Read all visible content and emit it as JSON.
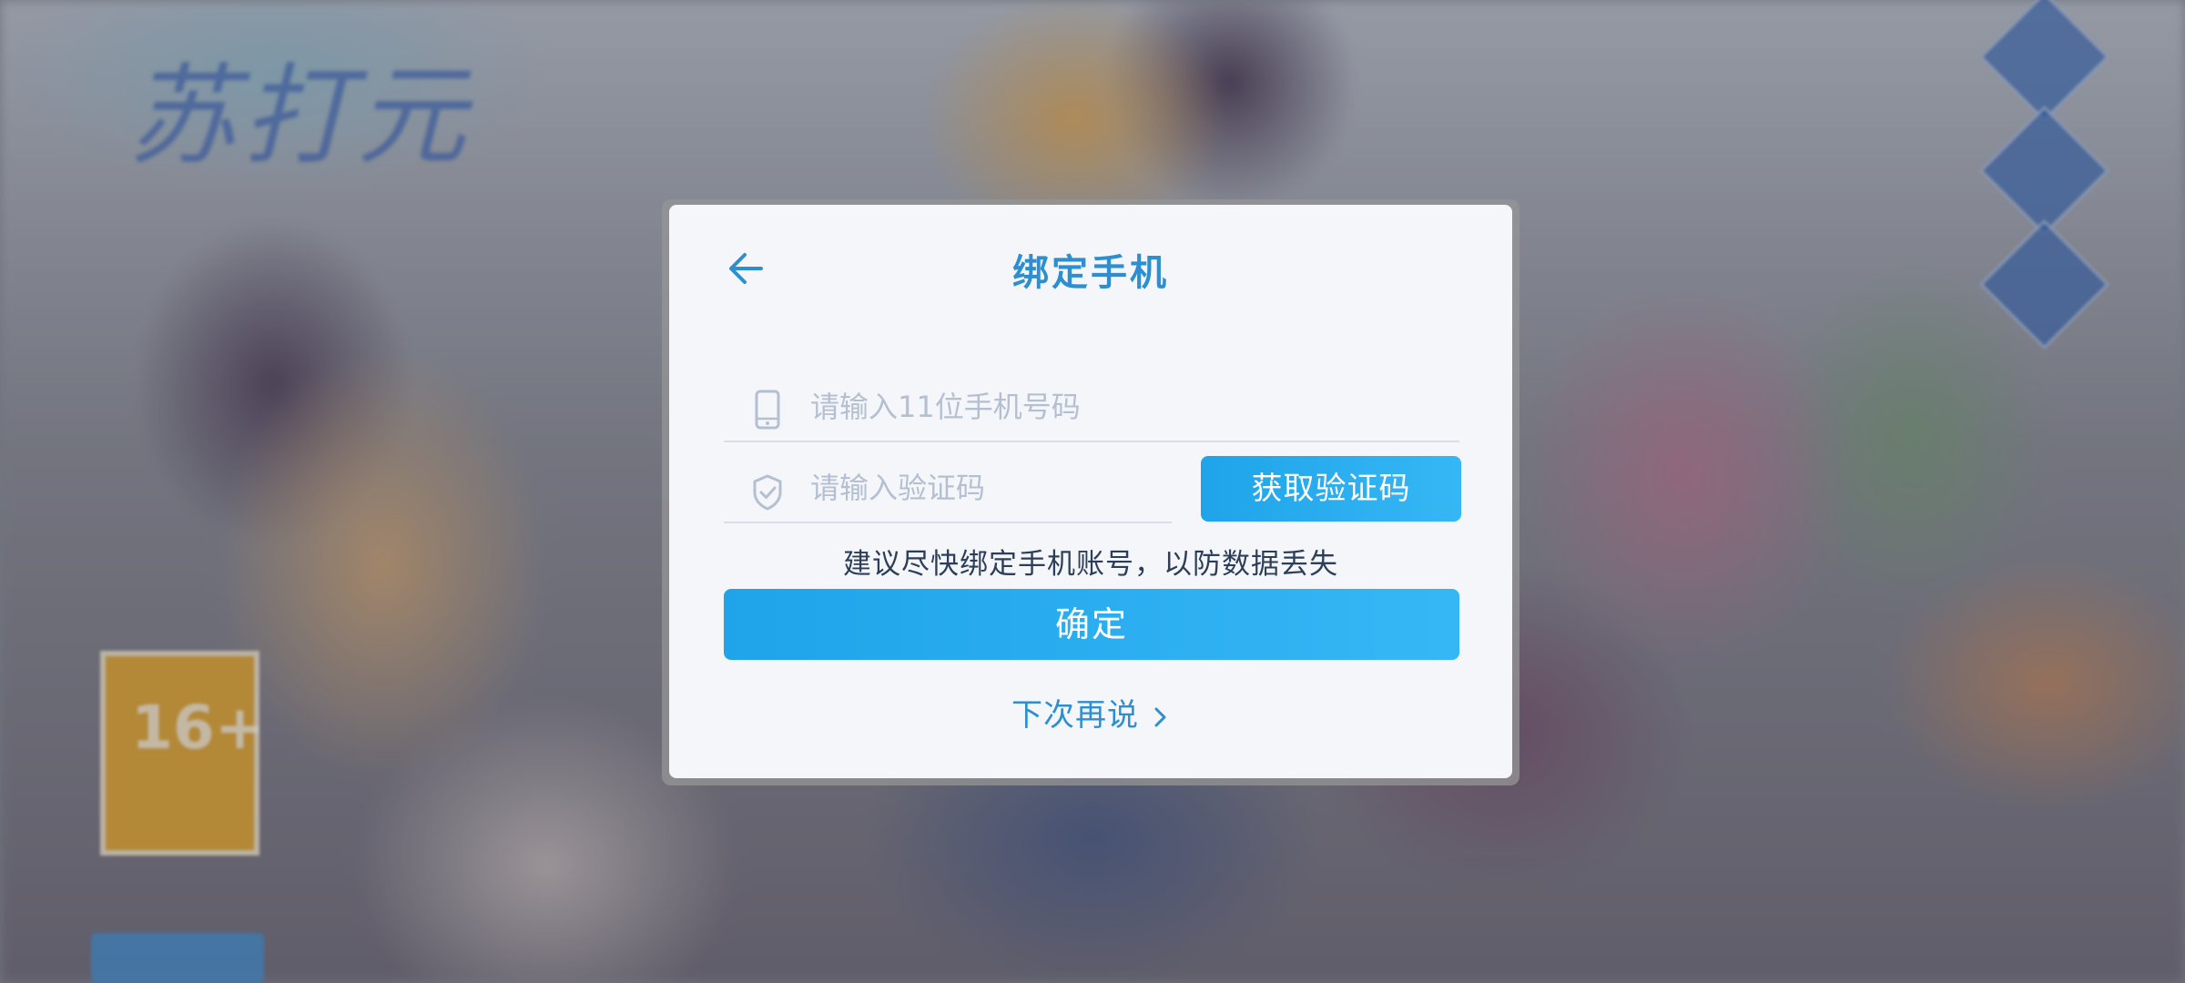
{
  "background": {
    "logo_text": "苏打元",
    "age_rating": "16+"
  },
  "dialog": {
    "title": "绑定手机",
    "back_icon": "arrow-left-icon",
    "phone_field": {
      "icon": "mobile-phone-icon",
      "placeholder": "请输入11位手机号码",
      "value": ""
    },
    "code_field": {
      "icon": "shield-check-icon",
      "placeholder": "请输入验证码",
      "value": ""
    },
    "get_code_label": "获取验证码",
    "hint": "建议尽快绑定手机账号，以防数据丢失",
    "confirm_label": "确定",
    "later_label": "下次再说",
    "later_icon": "chevron-right-icon"
  },
  "colors": {
    "accent": "#2E8FD0",
    "button": "#22A6EC",
    "dialog_bg": "#F4F6F9",
    "placeholder": "#B4C0D2",
    "hint_text": "#2C3E5A"
  }
}
